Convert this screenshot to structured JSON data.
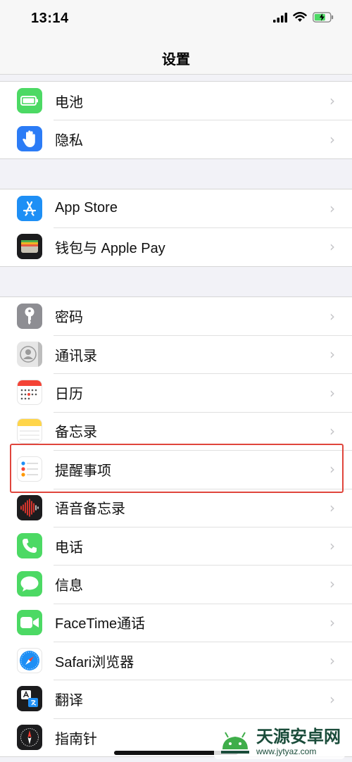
{
  "status_bar": {
    "time": "13:14"
  },
  "nav": {
    "title": "设置"
  },
  "groups": [
    {
      "rows": [
        {
          "label": "电池",
          "icon": "battery-icon",
          "color": "#4cd964"
        },
        {
          "label": "隐私",
          "icon": "hand-icon",
          "color": "#2c7cf6"
        }
      ]
    },
    {
      "rows": [
        {
          "label": "App Store",
          "icon": "app-store-icon",
          "color": "#1e8ff5"
        },
        {
          "label": "钱包与 Apple Pay",
          "icon": "wallet-icon",
          "color": "#1c1c1e"
        }
      ]
    },
    {
      "rows": [
        {
          "label": "密码",
          "icon": "key-icon",
          "color": "#8e8e93"
        },
        {
          "label": "通讯录",
          "icon": "contacts-icon",
          "color": "#d8d8d8"
        },
        {
          "label": "日历",
          "icon": "calendar-icon",
          "color": "#ffffff"
        },
        {
          "label": "备忘录",
          "icon": "notes-icon",
          "color": "#ffd54a"
        },
        {
          "label": "提醒事项",
          "icon": "reminders-icon",
          "color": "#ffffff"
        },
        {
          "label": "语音备忘录",
          "icon": "voice-memos-icon",
          "color": "#1c1c1e"
        },
        {
          "label": "电话",
          "icon": "phone-icon",
          "color": "#4cd964"
        },
        {
          "label": "信息",
          "icon": "messages-icon",
          "color": "#4cd964"
        },
        {
          "label": "FaceTime通话",
          "icon": "facetime-icon",
          "color": "#4cd964"
        },
        {
          "label": "Safari浏览器",
          "icon": "safari-icon",
          "color": "#ffffff"
        },
        {
          "label": "翻译",
          "icon": "translate-icon",
          "color": "#1c1c1e"
        },
        {
          "label": "指南针",
          "icon": "compass-icon",
          "color": "#1c1c1e"
        }
      ]
    }
  ],
  "chevron": "›",
  "watermark": {
    "title": "天源安卓网",
    "url": "www.jytyaz.com"
  }
}
